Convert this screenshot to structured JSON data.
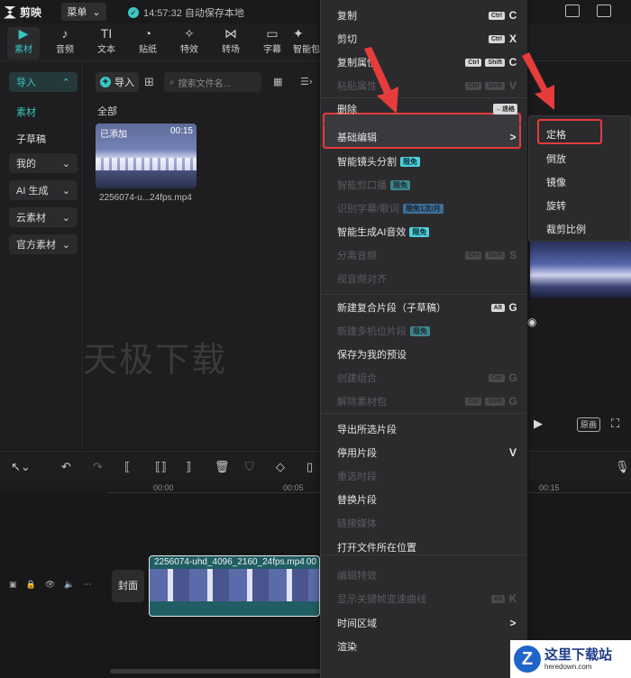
{
  "app": {
    "name": "剪映",
    "menu_label": "菜单",
    "save_status": "14:57:32 自动保存本地"
  },
  "toolbar": [
    {
      "label": "素材",
      "icon": "media-icon"
    },
    {
      "label": "音频",
      "icon": "audio-icon"
    },
    {
      "label": "文本",
      "icon": "text-icon"
    },
    {
      "label": "贴纸",
      "icon": "sticker-icon"
    },
    {
      "label": "特效",
      "icon": "effects-icon"
    },
    {
      "label": "转场",
      "icon": "transition-icon"
    },
    {
      "label": "字幕",
      "icon": "subtitle-icon"
    },
    {
      "label": "智能包",
      "icon": "smart-pack-icon"
    }
  ],
  "leftnav": {
    "import": "导入",
    "material": "素材",
    "draft": "子草稿",
    "mine": "我的",
    "ai": "AI 生成",
    "cloud": "云素材",
    "official": "官方素材"
  },
  "media": {
    "import_label": "导入",
    "search_placeholder": "搜索文件名...",
    "filter_all": "全部",
    "item": {
      "added": "已添加",
      "duration": "00:15",
      "filename": "2256074-u...24fps.mp4"
    }
  },
  "watermark": "天极下载",
  "timeline": {
    "ticks": [
      "00:00",
      "00:05",
      "00:15"
    ],
    "cover_label": "封面",
    "clip_label": "2256074-uhd_4096_2160_24fps.mp4",
    "clip_time": "00"
  },
  "player": {
    "ratio_label": "原画"
  },
  "context_menu": [
    {
      "label": "复制",
      "keys": [
        "Ctrl"
      ],
      "key": "C",
      "disabled": false
    },
    {
      "label": "剪切",
      "keys": [
        "Ctrl"
      ],
      "key": "X",
      "disabled": false
    },
    {
      "label": "复制属性",
      "keys": [
        "Ctrl",
        "Shift"
      ],
      "key": "C",
      "disabled": false
    },
    {
      "label": "粘贴属性",
      "keys": [
        "Ctrl",
        "Shift"
      ],
      "key": "V",
      "disabled": true
    },
    {
      "label": "删除",
      "keys": [
        "←退格"
      ],
      "key": "",
      "disabled": false
    },
    {
      "label": "基础编辑",
      "keys": [],
      "key": ">",
      "disabled": false
    },
    {
      "label": "智能镜头分割",
      "badge": "限免",
      "disabled": false
    },
    {
      "label": "智能剪口播",
      "badge": "限免",
      "disabled": true
    },
    {
      "label": "识别字幕/歌词",
      "badge": "限免1次/月",
      "disabled": true
    },
    {
      "label": "智能生成AI音效",
      "badge": "限免",
      "disabled": false
    },
    {
      "label": "分离音频",
      "keys": [
        "Ctrl",
        "Shift"
      ],
      "key": "S",
      "disabled": true
    },
    {
      "label": "视音频对齐",
      "disabled": true
    },
    {
      "label": "新建复合片段（子草稿）",
      "keys": [
        "Alt"
      ],
      "key": "G",
      "disabled": false
    },
    {
      "label": "新建多机位片段",
      "badge": "限免",
      "disabled": true
    },
    {
      "label": "保存为我的预设",
      "disabled": false
    },
    {
      "label": "创建组合",
      "keys": [
        "Ctrl"
      ],
      "key": "G",
      "disabled": true
    },
    {
      "label": "解除素材包",
      "keys": [
        "Ctrl",
        "Shift"
      ],
      "key": "G",
      "disabled": true
    },
    {
      "label": "导出所选片段",
      "disabled": false
    },
    {
      "label": "停用片段",
      "key": "V",
      "disabled": false
    },
    {
      "label": "重选时段",
      "disabled": true
    },
    {
      "label": "替换片段",
      "disabled": false
    },
    {
      "label": "链接媒体",
      "disabled": true
    },
    {
      "label": "打开文件所在位置",
      "disabled": false
    },
    {
      "label": "编辑特效",
      "disabled": true
    },
    {
      "label": "显示关键帧变速曲线",
      "keys": [
        "Alt"
      ],
      "key": "K",
      "disabled": true
    },
    {
      "label": "时间区域",
      "key": ">",
      "disabled": false
    },
    {
      "label": "渲染",
      "key": ">",
      "disabled": false
    }
  ],
  "submenu": [
    "定格",
    "倒放",
    "镜像",
    "旋转",
    "裁剪比例"
  ],
  "site_logo": {
    "title": "这里下载站",
    "url_text": "heredown.com"
  },
  "colors": {
    "accent": "#39c6c1",
    "highlight_box": "#e63c3c",
    "arrow": "#e63c3c"
  }
}
